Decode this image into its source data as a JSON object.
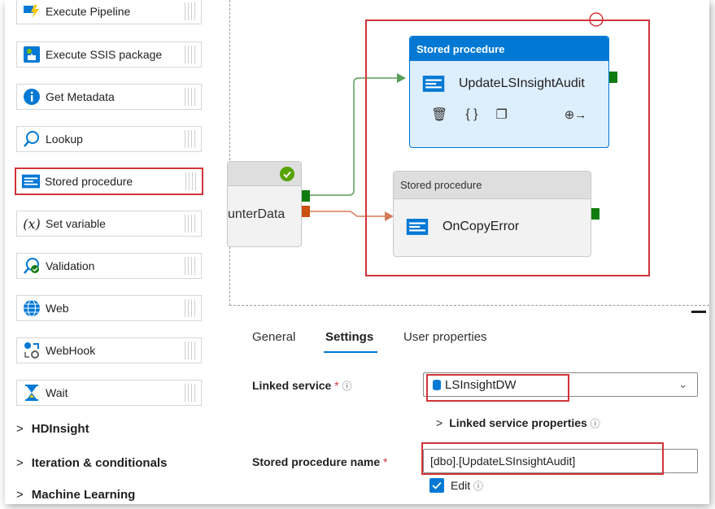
{
  "sidebar": {
    "activities": [
      {
        "label": "Execute Pipeline",
        "icon": "execute-pipeline-icon"
      },
      {
        "label": "Execute SSIS package",
        "icon": "ssis-package-icon"
      },
      {
        "label": "Get Metadata",
        "icon": "info-icon"
      },
      {
        "label": "Lookup",
        "icon": "lookup-icon"
      },
      {
        "label": "Stored procedure",
        "icon": "stored-procedure-icon"
      },
      {
        "label": "Set variable",
        "icon": "variable-icon"
      },
      {
        "label": "Validation",
        "icon": "validation-icon"
      },
      {
        "label": "Web",
        "icon": "globe-icon"
      },
      {
        "label": "WebHook",
        "icon": "webhook-icon"
      },
      {
        "label": "Wait",
        "icon": "hourglass-icon"
      }
    ],
    "groups": [
      {
        "label": "HDInsight"
      },
      {
        "label": "Iteration & conditionals"
      },
      {
        "label": "Machine Learning"
      }
    ]
  },
  "canvas": {
    "source_node": {
      "name": "unterData"
    },
    "node_update": {
      "type_label": "Stored procedure",
      "name": "UpdateLSInsightAudit"
    },
    "node_error": {
      "type_label": "Stored procedure",
      "name": "OnCopyError"
    }
  },
  "panel": {
    "tabs": [
      {
        "label": "General"
      },
      {
        "label": "Settings"
      },
      {
        "label": "User properties"
      }
    ],
    "active_tab": "Settings",
    "linked_service": {
      "label": "Linked service",
      "required": "*",
      "value": "LSInsightDW"
    },
    "linked_service_properties": {
      "label": "Linked service properties"
    },
    "stored_proc": {
      "label": "Stored procedure name",
      "required": "*",
      "value": "[dbo].[UpdateLSInsightAudit]"
    },
    "edit": {
      "label": "Edit",
      "checked": true
    }
  },
  "colors": {
    "accent": "#0078d4",
    "highlight": "#d13438",
    "success": "#107c10",
    "failure": "#ca5010"
  }
}
